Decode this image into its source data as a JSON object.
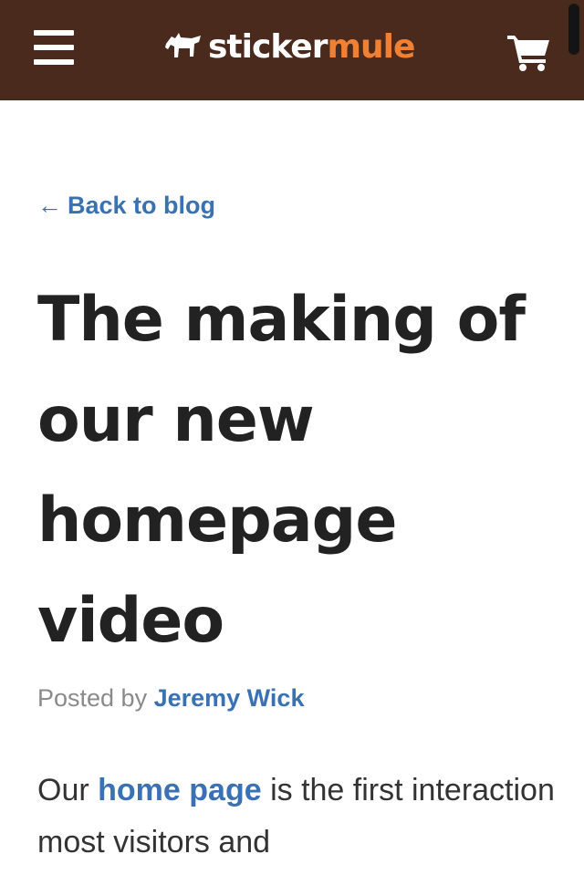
{
  "header": {
    "logo": {
      "part1": "sticker",
      "part2": "mule"
    },
    "menu_icon": "hamburger-menu-icon",
    "cart_icon": "shopping-cart-icon",
    "colors": {
      "background": "#4a2a1d",
      "logo_accent": "#f08134"
    }
  },
  "back_link": {
    "arrow": "←",
    "label": "Back to blog"
  },
  "post": {
    "title": "The making of our new homepage video",
    "byline_prefix": "Posted by",
    "author": "Jeremy Wick",
    "body": {
      "before": "Our",
      "link": "home page",
      "after": "is the first interaction most visitors and"
    }
  },
  "colors": {
    "link": "#3a71b3",
    "heading": "#222222",
    "muted": "#8a8a8a"
  }
}
